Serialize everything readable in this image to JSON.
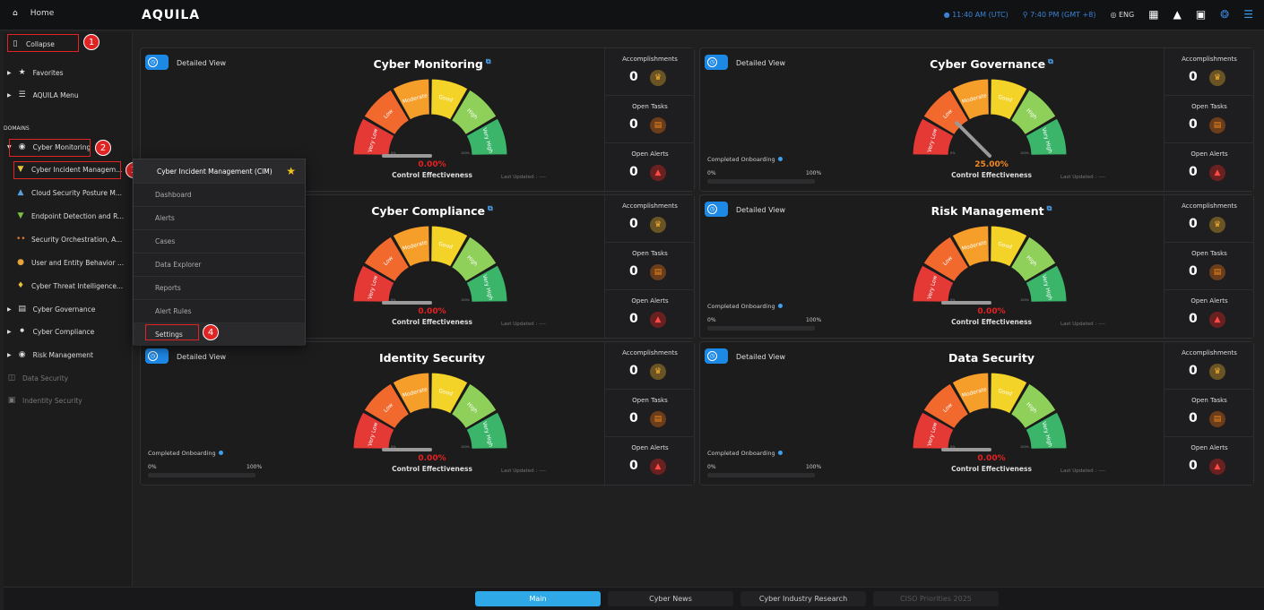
{
  "topbar": {
    "home_label": "Home",
    "logo": "AQUILA",
    "utc_time": "11:40 AM (UTC)",
    "local_time": "7:40 PM (GMT +8)",
    "language": "ENG"
  },
  "sidebar": {
    "collapse_label": "Collapse",
    "favorites_label": "Favorites",
    "aquila_menu_label": "AQUILA Menu",
    "domains_heading": "DOMAINS",
    "cyber_monitoring": "Cyber Monitoring",
    "subitems": [
      "Cyber Incident Managem...",
      "Cloud Security Posture M...",
      "Endpoint Detection and R...",
      "Security Orchestration, A...",
      "User and Entity Behavior ...",
      "Cyber Threat Intelligence..."
    ],
    "cyber_governance": "Cyber Governance",
    "cyber_compliance": "Cyber Compliance",
    "risk_management": "Risk Management",
    "data_security": "Data Security",
    "identity_security": "Indentity Security"
  },
  "badges": [
    "1",
    "2",
    "3",
    "4"
  ],
  "popup": {
    "title": "Cyber Incident Management (CIM)",
    "items": [
      "Dashboard",
      "Alerts",
      "Cases",
      "Data Explorer",
      "Reports",
      "Alert Rules",
      "Settings"
    ]
  },
  "common": {
    "detailed_view": "Detailed View",
    "control_effectiveness": "Control Effectiveness",
    "last_updated": "Last Updated : ----",
    "completed_onboarding": "Completed Onboarding",
    "onb_min": "0%",
    "onb_max": "100%",
    "accomplishments": "Accomplishments",
    "open_tasks": "Open Tasks",
    "open_alerts": "Open Alerts",
    "gauge_segments": [
      "Very Low",
      "Low",
      "Moderate",
      "Good",
      "High",
      "Very High"
    ],
    "gauge_min": "0%",
    "gauge_max": "100%"
  },
  "cards": [
    {
      "title": "Cyber Monitoring",
      "percent": "0.00%",
      "accomplishments": "0",
      "open_tasks": "0",
      "open_alerts": "0"
    },
    {
      "title": "Cyber Governance",
      "percent": "25.00%",
      "accomplishments": "0",
      "open_tasks": "0",
      "open_alerts": "0"
    },
    {
      "title": "Cyber Compliance",
      "percent": "0.00%",
      "accomplishments": "0",
      "open_tasks": "0",
      "open_alerts": "0"
    },
    {
      "title": "Risk Management",
      "percent": "0.00%",
      "accomplishments": "0",
      "open_tasks": "0",
      "open_alerts": "0"
    },
    {
      "title": "Identity Security",
      "percent": "0.00%",
      "accomplishments": "0",
      "open_tasks": "0",
      "open_alerts": "0"
    },
    {
      "title": "Data Security",
      "percent": "0.00%",
      "accomplishments": "0",
      "open_tasks": "0",
      "open_alerts": "0"
    }
  ],
  "bottom_tabs": [
    "Main",
    "Cyber News",
    "Cyber Industry Research",
    "CISO Priorities 2025"
  ],
  "colors": {
    "accent": "#2fa8e8",
    "alert_red": "#e02424",
    "percent_red": "#e32222",
    "percent_orange": "#f58a1f"
  }
}
